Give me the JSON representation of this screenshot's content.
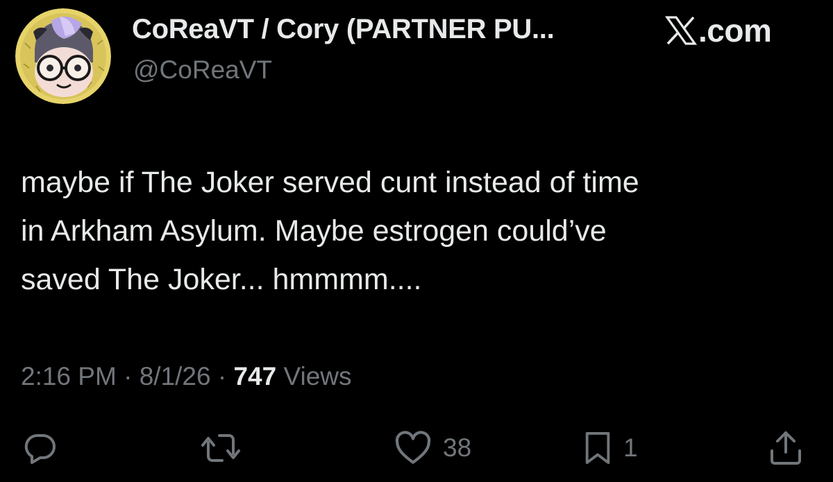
{
  "header": {
    "display_name": "CoReaVT / Cory (PARTNER PU...",
    "handle": "@CoReaVT",
    "brand": ".com"
  },
  "tweet": {
    "lines": [
      "maybe if The Joker served cunt instead of time",
      "in Arkham Asylum. Maybe estrogen could’ve",
      "saved The Joker... hmmmm...."
    ]
  },
  "meta": {
    "time": "2:16 PM",
    "separator": " · ",
    "date": "8/1/26",
    "views_count": "747",
    "views_label": "Views"
  },
  "actions": {
    "reply_icon": "reply-icon",
    "retweet_icon": "retweet-icon",
    "like_icon": "heart-icon",
    "like_count": "38",
    "bookmark_icon": "bookmark-icon",
    "bookmark_count": "1",
    "share_icon": "share-icon"
  },
  "colors": {
    "background": "#000000",
    "primary_text": "#e7e9ea",
    "secondary_text": "#71767b"
  }
}
